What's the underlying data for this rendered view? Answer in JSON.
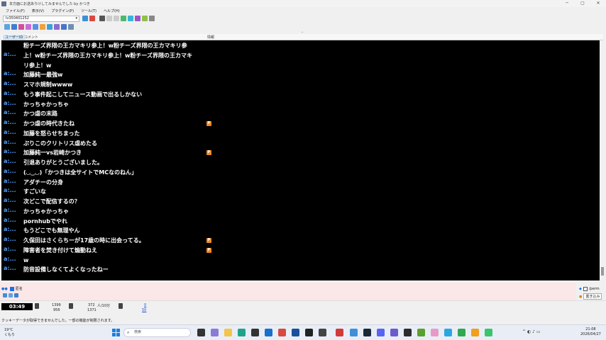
{
  "window": {
    "title": "本方面にお送ありけしてみませんでした by かつき",
    "controls": [
      "─",
      "▢",
      "✕"
    ]
  },
  "menu": [
    "ファイル(F)",
    "表示(V)",
    "プラグイン(P)",
    "ツール(T)",
    "ヘルプ(H)"
  ],
  "toolbar": {
    "live_id": "lv350401252",
    "combo_arrow": "▾"
  },
  "columns": {
    "user_id": "ユーザーID",
    "comment": "コメント",
    "info": "情報"
  },
  "comments": [
    {
      "uid": "",
      "text": "粉チーズ界隈の王カマキリ参上！w粉チーズ界隈の王カマキリ参",
      "mark": ""
    },
    {
      "uid": "a:...",
      "text": "上！w粉チーズ界隈の王カマキリ参上！w粉チーズ界隈の王カマキ",
      "mark": ""
    },
    {
      "uid": "",
      "text": "リ参上！w",
      "mark": ""
    },
    {
      "uid": "a:...",
      "text": "加藤純一最強w",
      "mark": ""
    },
    {
      "uid": "a:...",
      "text": "スマホ規制wwww",
      "mark": ""
    },
    {
      "uid": "a:...",
      "text": "もう事件起こしてニュース動画で出るしかない",
      "mark": ""
    },
    {
      "uid": "a:...",
      "text": "かっちゃかっちゃ",
      "mark": ""
    },
    {
      "uid": "a:...",
      "text": "かつ虐の末路",
      "mark": ""
    },
    {
      "uid": "a:...",
      "text": "かつ虐の時代きたね",
      "mark": "P"
    },
    {
      "uid": "a:...",
      "text": "加藤を怒らせちまった",
      "mark": ""
    },
    {
      "uid": "a:...",
      "text": "ぷりこのクリトリス虐めたる",
      "mark": ""
    },
    {
      "uid": "a:...",
      "text": "加藤純一vs岩崎かつき",
      "mark": "P"
    },
    {
      "uid": "a:...",
      "text": "引退ありがとうございました。",
      "mark": ""
    },
    {
      "uid": "a:...",
      "text": "(◡‿◡)「かつきは全サイトでMCなのねん」",
      "mark": ""
    },
    {
      "uid": "a:...",
      "text": "アダチーの分身",
      "mark": ""
    },
    {
      "uid": "a:...",
      "text": "すごいな",
      "mark": ""
    },
    {
      "uid": "a:...",
      "text": "次どこで配信するの？",
      "mark": ""
    },
    {
      "uid": "a:...",
      "text": "かっちゃかっちゃ",
      "mark": ""
    },
    {
      "uid": "a:...",
      "text": "pornhubでやれ",
      "mark": ""
    },
    {
      "uid": "a:...",
      "text": "もうどこでも無理やん",
      "mark": ""
    },
    {
      "uid": "a:...",
      "text": "久保田はさくらちーが17歳の時に出会ってる。",
      "mark": "P"
    },
    {
      "uid": "a:...",
      "text": "障害者を焚き付けて煽動ねえ",
      "mark": "P"
    },
    {
      "uid": "a:...",
      "text": "w",
      "mark": ""
    },
    {
      "uid": "a:...",
      "text": "防音設備しなくてよくなったねー",
      "mark": ""
    }
  ],
  "input": {
    "option_label": "匿名",
    "perm_label": "/perm",
    "write_button": "書き込み"
  },
  "stats": {
    "elapsed": "03:49",
    "comments_total": "1399",
    "comments_sub": "956",
    "viewers_rate": "372",
    "viewers_unit": "人/10分",
    "viewers_total": "1371",
    "ad_top": "0",
    "ad_bottom": "50"
  },
  "status_message": "クッキーデータが取得できませんでした。一部の機能が制限されます。",
  "taskbar": {
    "temperature": "19°C",
    "weather": "くもり",
    "search_placeholder": "検索",
    "time": "21:08",
    "date": "2026/04/27"
  },
  "colors": {
    "comment_bg": "#000000",
    "uid_color": "#4fa3ff",
    "input_bg": "#fbe7e7",
    "accent": "#1f6fe0"
  }
}
